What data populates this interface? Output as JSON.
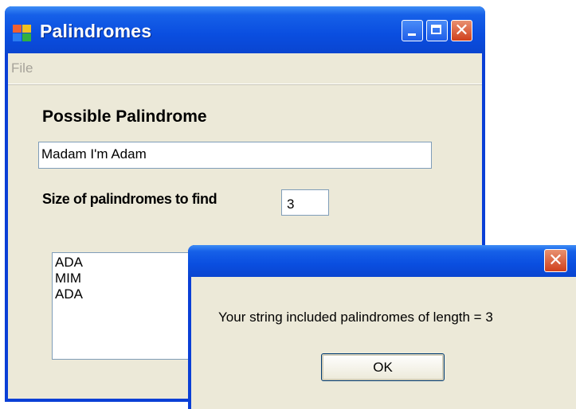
{
  "window": {
    "title": "Palindromes",
    "icon": "app-windows-icon",
    "controls": [
      "minimize-icon",
      "maximize-icon",
      "close-icon"
    ]
  },
  "menu": {
    "file_label": "File"
  },
  "form": {
    "heading": "Possible Palindrome",
    "input_value": "Madam I'm Adam",
    "size_label": "Size of palindromes to find",
    "size_value": "3",
    "results": [
      "ADA",
      "MIM",
      "ADA"
    ]
  },
  "dialog": {
    "message": "Your string included palindromes of length = 3",
    "ok_label": "OK",
    "close_icon": "close-icon"
  },
  "colors": {
    "titlebar": "#0a4ee0",
    "window_face": "#ece9d8",
    "close_button": "#d0401c"
  }
}
